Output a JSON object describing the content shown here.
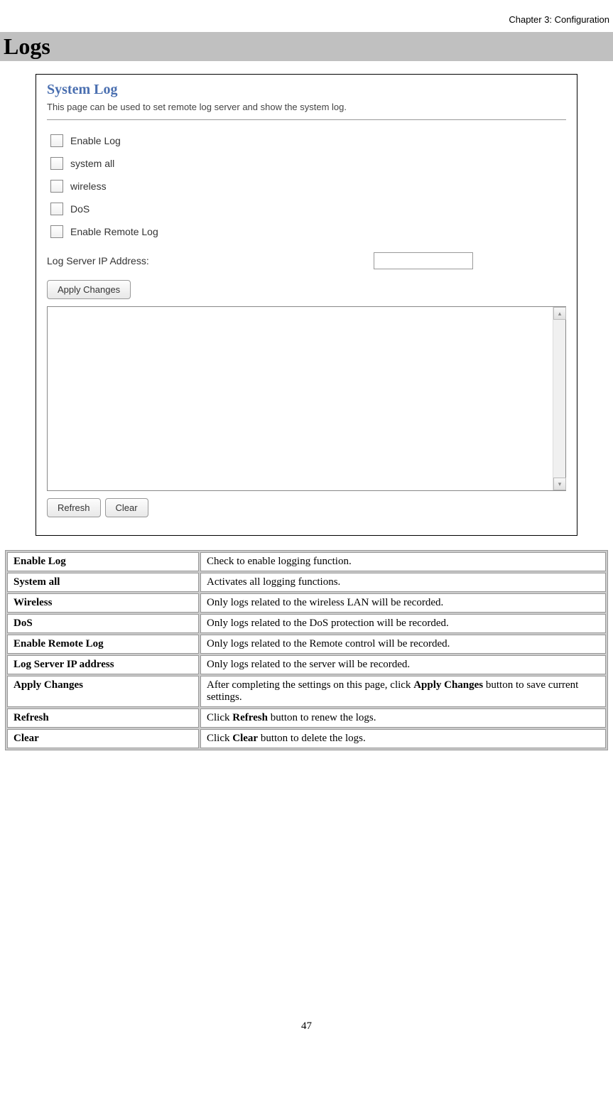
{
  "header": "Chapter 3: Configuration",
  "section_title": "Logs",
  "system_log": {
    "title": "System Log",
    "description": "This page can be used to set remote log server and show the system log.",
    "checkboxes": [
      "Enable Log",
      "system all",
      "wireless",
      "DoS",
      "Enable Remote Log"
    ],
    "ip_label": "Log Server IP Address:",
    "ip_value": "",
    "apply_button": "Apply Changes",
    "refresh_button": "Refresh",
    "clear_button": "Clear"
  },
  "table": {
    "rows": [
      {
        "label": "Enable Log",
        "desc_parts": [
          {
            "t": "Check to enable logging function."
          }
        ]
      },
      {
        "label": "System all",
        "desc_parts": [
          {
            "t": "Activates all logging functions."
          }
        ]
      },
      {
        "label": "Wireless",
        "desc_parts": [
          {
            "t": "Only logs related to the wireless LAN will be recorded."
          }
        ]
      },
      {
        "label": "DoS",
        "desc_parts": [
          {
            "t": "Only logs related to the DoS protection will be recorded."
          }
        ]
      },
      {
        "label": "Enable Remote Log",
        "desc_parts": [
          {
            "t": "Only logs related to the Remote control will be recorded."
          }
        ]
      },
      {
        "label": "Log Server IP address",
        "desc_parts": [
          {
            "t": "Only logs related to the server will be recorded."
          }
        ]
      },
      {
        "label": "Apply Changes",
        "desc_parts": [
          {
            "t": "After completing the settings on this page, click "
          },
          {
            "t": "Apply Changes",
            "bold": true
          },
          {
            "t": " button to save current settings."
          }
        ]
      },
      {
        "label": "Refresh",
        "desc_parts": [
          {
            "t": "Click "
          },
          {
            "t": "Refresh",
            "bold": true
          },
          {
            "t": " button to renew the logs."
          }
        ]
      },
      {
        "label": "Clear",
        "desc_parts": [
          {
            "t": "Click "
          },
          {
            "t": "Clear",
            "bold": true
          },
          {
            "t": " button to delete the logs."
          }
        ]
      }
    ]
  },
  "page_number": "47"
}
